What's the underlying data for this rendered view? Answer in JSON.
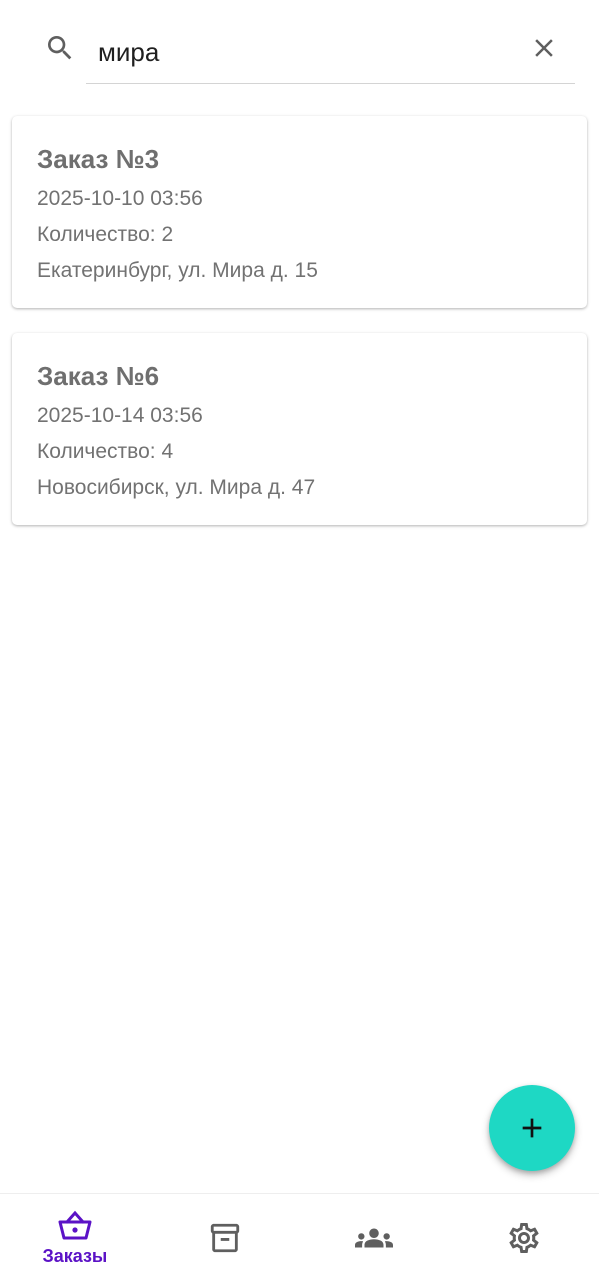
{
  "search": {
    "value": "мира"
  },
  "orders": [
    {
      "title": "Заказ №3",
      "datetime": "2025-10-10 03:56",
      "quantity": "Количество: 2",
      "address": "Екатеринбург, ул. Мира д. 15"
    },
    {
      "title": "Заказ №6",
      "datetime": "2025-10-14 03:56",
      "quantity": "Количество: 4",
      "address": "Новосибирск, ул. Мира д. 47"
    }
  ],
  "fab": {
    "icon": "plus-icon",
    "color": "#1ed8c4"
  },
  "bottom_nav": {
    "active_color": "#5b12c6",
    "inactive_color": "#5f5f5f",
    "items": [
      {
        "icon": "basket-icon",
        "label": "Заказы",
        "active": true
      },
      {
        "icon": "archive-icon",
        "active": false
      },
      {
        "icon": "group-icon",
        "active": false
      },
      {
        "icon": "gear-icon",
        "active": false
      }
    ]
  }
}
